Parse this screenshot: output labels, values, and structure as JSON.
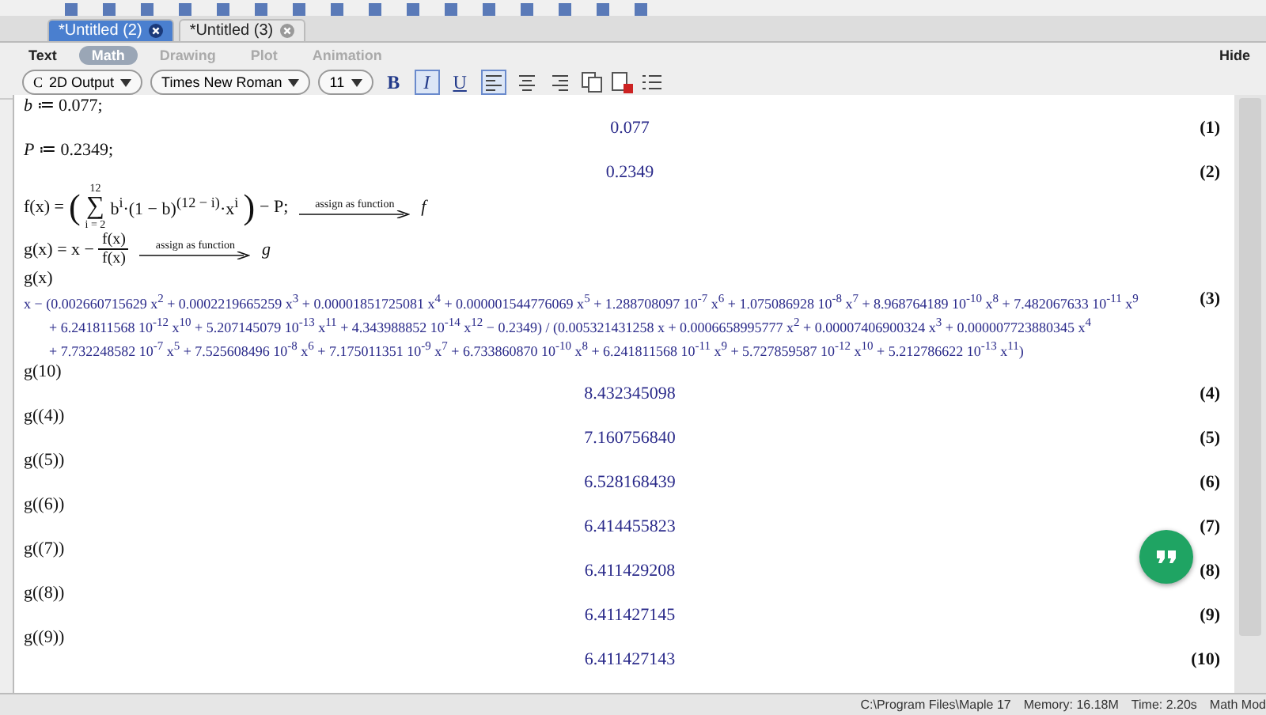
{
  "doc_tabs": [
    {
      "label": "*Untitled (2)",
      "selected": true
    },
    {
      "label": "*Untitled (3)",
      "selected": false
    }
  ],
  "context_tabs": [
    {
      "label": "Text",
      "selected": false,
      "disabled": false
    },
    {
      "label": "Math",
      "selected": true,
      "disabled": false
    },
    {
      "label": "Drawing",
      "selected": false,
      "disabled": true
    },
    {
      "label": "Plot",
      "selected": false,
      "disabled": true
    },
    {
      "label": "Animation",
      "selected": false,
      "disabled": true
    }
  ],
  "hide_label": "Hide",
  "format_bar": {
    "mode_icon": "C",
    "mode": "2D Output",
    "font": "Times New Roman",
    "size": "11",
    "bold": {
      "label": "B",
      "on": false
    },
    "italic": {
      "label": "I",
      "on": true
    },
    "underline": {
      "label": "U",
      "on": false
    },
    "align": [
      {
        "selected": true
      },
      {
        "selected": false
      },
      {
        "selected": false
      }
    ]
  },
  "worksheet": [
    {
      "kind": "input",
      "text": "*b* ≔ 0.077;"
    },
    {
      "kind": "output",
      "text": "0.077",
      "label": "(1)"
    },
    {
      "kind": "input",
      "text": "*P* ≔ 0.2349;"
    },
    {
      "kind": "output",
      "text": "0.2349",
      "label": "(2)"
    },
    {
      "kind": "sum",
      "lhs": "f(x) =",
      "open": "(",
      "close": ")",
      "sigma": "∑",
      "upper": "12",
      "lower": "i = 2",
      "body": "b$^{i}$·(1 − b)$^{(12 − i)}$·x$^{i}$",
      "tail": "− P;",
      "arrow": "assign as function",
      "result": "f"
    },
    {
      "kind": "fraction",
      "lhs": "g(x) = x −",
      "numerator": "f(x)",
      "denominator": "f(x)",
      "arrow": "assign as function",
      "result": "g"
    },
    {
      "kind": "input",
      "text": "g(x)"
    },
    {
      "kind": "long",
      "label": "(3)",
      "lines": [
        "x − (0.002660715629 x$^{2}$ + 0.0002219665259 x$^{3}$ + 0.00001851725081 x$^{4}$ + 0.000001544776069 x$^{5}$ + 1.288708097 10$^{-7}$ x$^{6}$ + 1.075086928 10$^{-8}$ x$^{7}$ + 8.968764189 10$^{-10}$ x$^{8}$ + 7.482067633 10$^{-11}$ x$^{9}$",
        "+ 6.241811568 10$^{-12}$ x$^{10}$ + 5.207145079 10$^{-13}$ x$^{11}$ + 4.343988852 10$^{-14}$ x$^{12}$ − 0.2349) / (0.005321431258 x + 0.0006658995777 x$^{2}$ + 0.00007406900324 x$^{3}$ + 0.000007723880345 x$^{4}$",
        "+ 7.732248582 10$^{-7}$ x$^{5}$ + 7.525608496 10$^{-8}$ x$^{6}$ + 7.175011351 10$^{-9}$ x$^{7}$ + 6.733860870 10$^{-10}$ x$^{8}$ + 6.241811568 10$^{-11}$ x$^{9}$ + 5.727859587 10$^{-12}$ x$^{10}$ + 5.212786622 10$^{-13}$ x$^{11}$)"
      ]
    },
    {
      "kind": "input",
      "text": "g(10)"
    },
    {
      "kind": "output",
      "text": "8.432345098",
      "label": "(4)"
    },
    {
      "kind": "input",
      "text": "g((4))"
    },
    {
      "kind": "output",
      "text": "7.160756840",
      "label": "(5)"
    },
    {
      "kind": "input",
      "text": "g((5))"
    },
    {
      "kind": "output",
      "text": "6.528168439",
      "label": "(6)"
    },
    {
      "kind": "input",
      "text": "g((6))"
    },
    {
      "kind": "output",
      "text": "6.414455823",
      "label": "(7)"
    },
    {
      "kind": "input",
      "text": "g((7))"
    },
    {
      "kind": "output",
      "text": "6.411429208",
      "label": "(8)"
    },
    {
      "kind": "input",
      "text": "g((8))"
    },
    {
      "kind": "output",
      "text": "6.411427145",
      "label": "(9)"
    },
    {
      "kind": "input",
      "text": "g((9))"
    },
    {
      "kind": "output",
      "text": "6.411427143",
      "label": "(10)"
    }
  ],
  "status_bar": [
    "C:\\Program Files\\Maple 17",
    "Memory: 16.18M",
    "Time: 2.20s",
    "Math Mod"
  ]
}
